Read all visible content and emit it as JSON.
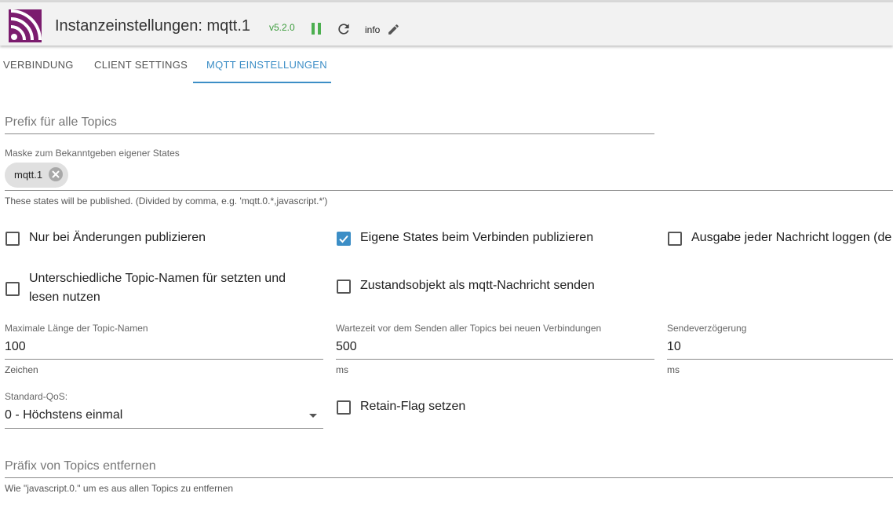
{
  "header": {
    "title": "Instanzeinstellungen: mqtt.1",
    "version": "v5.2.0",
    "log_level": "info",
    "brand_color": "#7b1c6e",
    "status_color": "#4caf50"
  },
  "tabs": [
    {
      "label": "VERBINDUNG",
      "active": false
    },
    {
      "label": "CLIENT SETTINGS",
      "active": false
    },
    {
      "label": "MQTT EINSTELLUNGEN",
      "active": true
    }
  ],
  "accent_color": "#3c8ec6",
  "prefix_field": {
    "placeholder": "Prefix für alle Topics"
  },
  "mask_field": {
    "label": "Maske zum Bekanntgeben eigener States",
    "chip": "mqtt.1",
    "helper": "These states will be published. (Divided by comma, e.g. 'mqtt.0.*,javascript.*')"
  },
  "checkboxes": {
    "only_changes": {
      "label": "Nur bei Änderungen publizieren",
      "checked": false
    },
    "publish_own_on_connect": {
      "label": "Eigene States beim Verbinden publizieren",
      "checked": true
    },
    "log_each_message": {
      "label": "Ausgabe jeder Nachricht loggen (de",
      "checked": false
    },
    "different_topic_names_line1": "Unterschiedliche Topic-Namen für setzten und",
    "different_topic_names_line2": "lesen nutzen",
    "different_topic_names_checked": false,
    "state_object": {
      "label": "Zustandsobjekt als mqtt-Nachricht senden",
      "checked": false
    },
    "retain_flag": {
      "label": "Retain-Flag setzen",
      "checked": false
    }
  },
  "max_topic_length": {
    "label": "Maximale Länge der Topic-Namen",
    "value": "100",
    "unit": "Zeichen"
  },
  "wait_time": {
    "label": "Wartezeit vor dem Senden aller Topics bei neuen Verbindungen",
    "value": "500",
    "unit": "ms"
  },
  "send_delay": {
    "label": "Sendeverzögerung",
    "value": "10",
    "unit": "ms"
  },
  "qos": {
    "label": "Standard-QoS:",
    "selected": "0 - Höchstens einmal"
  },
  "remove_prefix": {
    "placeholder": "Präfix von Topics entfernen",
    "helper": "Wie \"javascript.0.\" um es aus allen Topics zu entfernen"
  }
}
